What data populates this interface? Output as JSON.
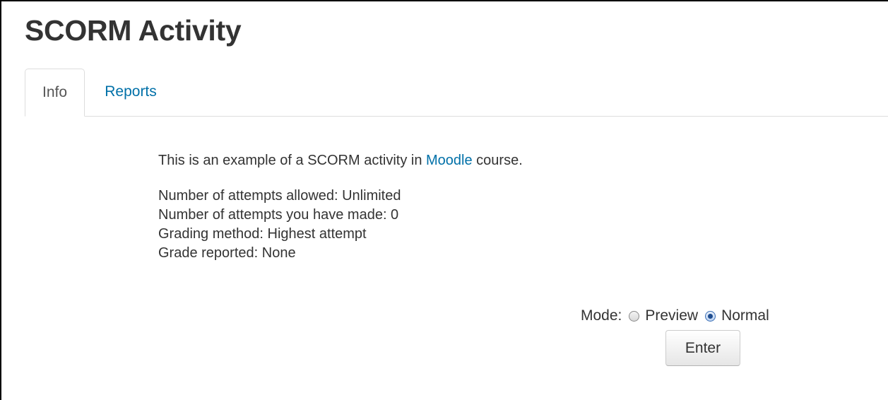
{
  "page": {
    "title": "SCORM Activity"
  },
  "tabs": [
    {
      "label": "Info",
      "active": true
    },
    {
      "label": "Reports",
      "active": false
    }
  ],
  "content": {
    "intro_before": "This is an example of a SCORM activity in ",
    "intro_link": "Moodle",
    "intro_after": " course.",
    "details": [
      "Number of attempts allowed: Unlimited",
      "Number of attempts you have made: 0",
      "Grading method: Highest attempt",
      "Grade reported: None"
    ]
  },
  "mode": {
    "label": "Mode:",
    "options": [
      {
        "label": "Preview",
        "selected": false
      },
      {
        "label": "Normal",
        "selected": true
      }
    ]
  },
  "actions": {
    "enter_label": "Enter"
  },
  "colors": {
    "link": "#0070a8",
    "text": "#333333",
    "border": "#dddddd"
  }
}
